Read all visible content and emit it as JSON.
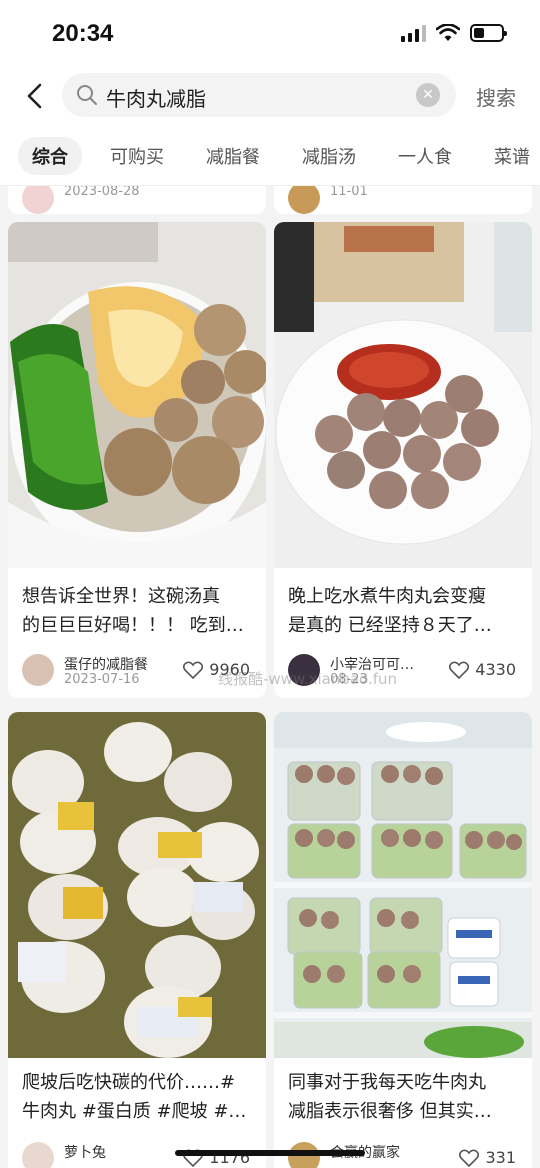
{
  "status_bar": {
    "time": "20:34"
  },
  "search": {
    "query": "牛肉丸减脂",
    "search_button": "搜索"
  },
  "tabs": [
    {
      "label": "综合",
      "active": true
    },
    {
      "label": "可购买"
    },
    {
      "label": "减脂餐"
    },
    {
      "label": "减脂汤"
    },
    {
      "label": "一人食"
    },
    {
      "label": "菜谱"
    }
  ],
  "partial_top": {
    "left_date": "2023-08-28",
    "right_date": "11-01"
  },
  "cards": [
    {
      "title": "想告诉全世界！这碗汤真的巨巨巨好喝！！！ 吃到…",
      "title_line1": "想告诉全世界！这碗汤真",
      "title_line2": "的巨巨巨好喝！！！ 吃到…",
      "author": "蛋仔的减脂餐",
      "date": "2023-07-16",
      "likes": "9960"
    },
    {
      "title_line1": "晚上吃水煮牛肉丸会变瘦",
      "title_line2": "是真的 已经坚持８天了…",
      "author": "小宰治可可…",
      "date": "08-23",
      "likes": "4330"
    },
    {
      "title_line1": "爬坡后吃快碳的代价……#",
      "title_line2": "牛肉丸 #蛋白质 #爬坡 #…",
      "author": "萝卜兔",
      "likes": "1176"
    },
    {
      "title_line1": "同事对于我每天吃牛肉丸",
      "title_line2": "减脂表示很奢侈 但其实…",
      "author": "会赢的赢家",
      "likes": "331"
    }
  ],
  "watermark": "线报酷-www.xianbao.fun",
  "colors": {
    "accent": "#ff2442",
    "background": "#f4f4f4"
  }
}
